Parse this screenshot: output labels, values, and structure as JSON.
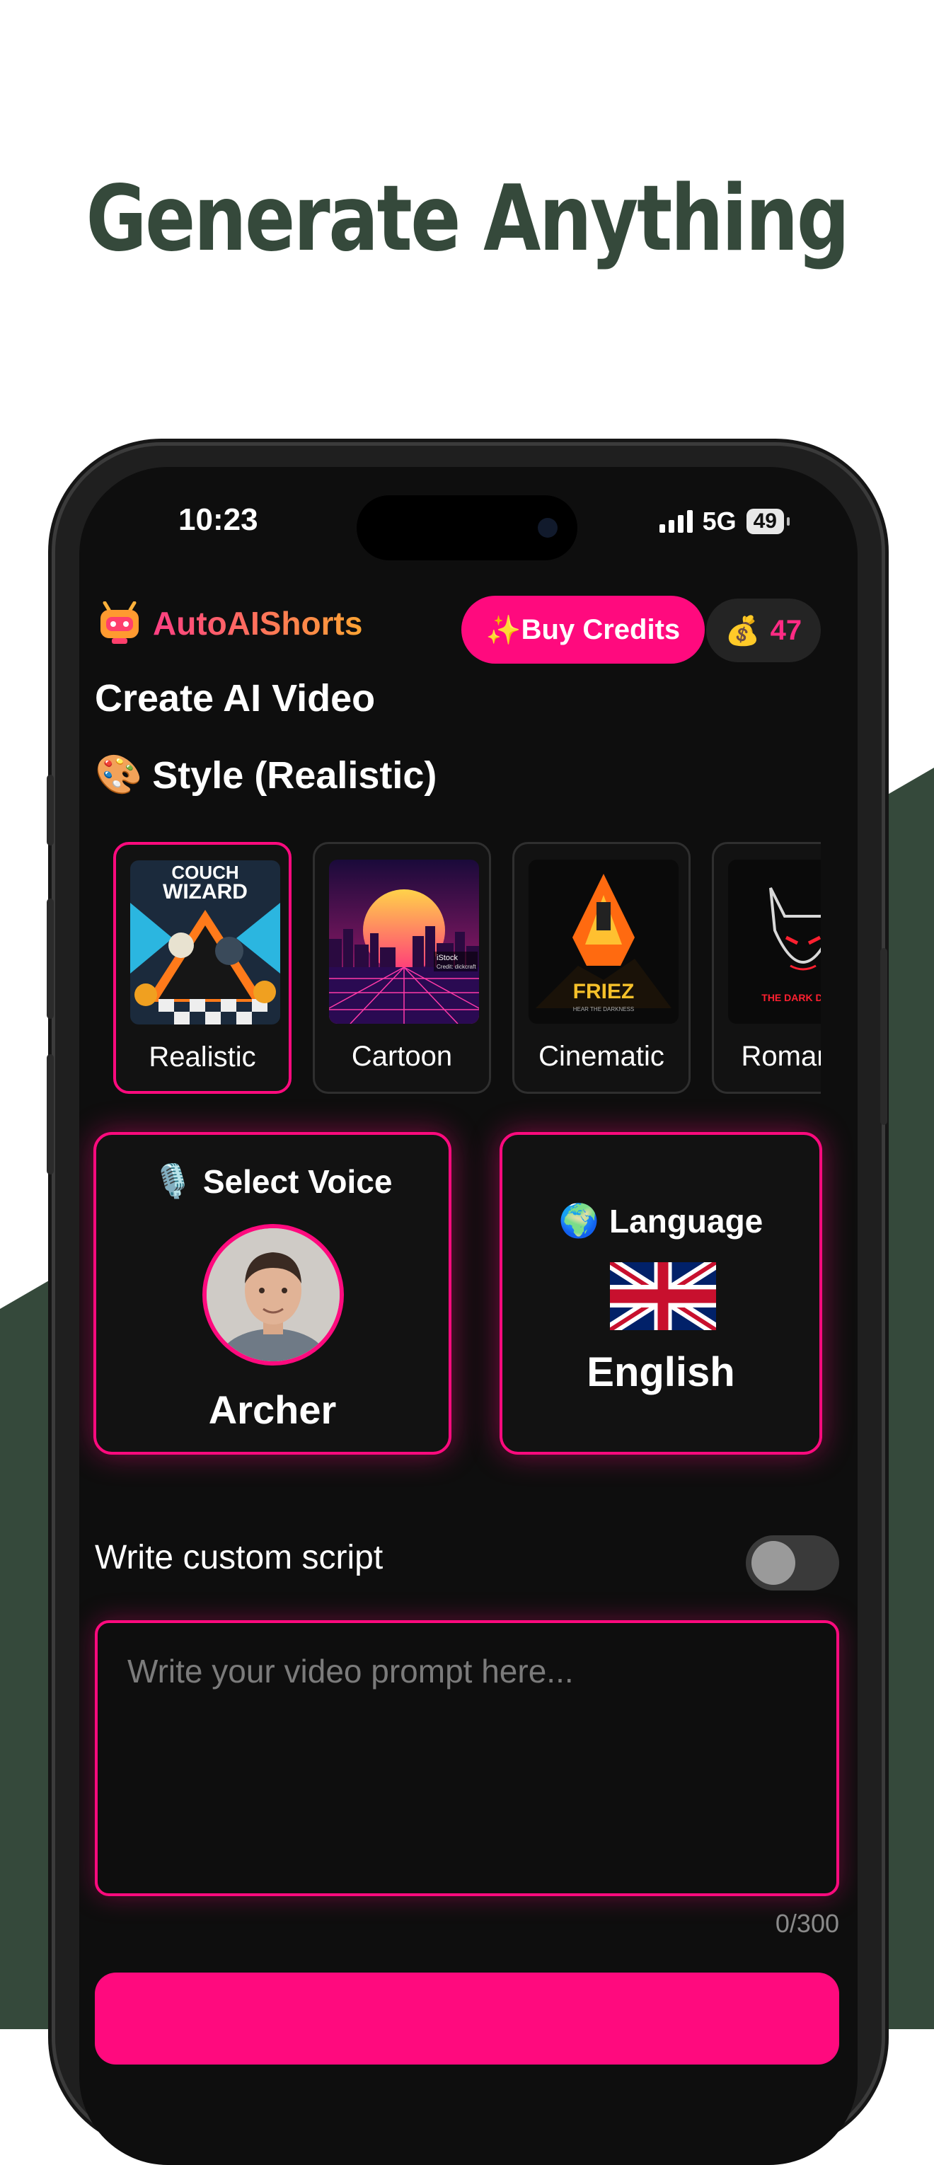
{
  "headline": "Generate Anything",
  "status_bar": {
    "time": "10:23",
    "network": "5G",
    "battery": "49"
  },
  "header": {
    "app_name": "AutoAIShorts",
    "buy_credits_label": "Buy Credits",
    "sparkle_emoji": "✨",
    "credits_emoji": "💰",
    "credits_count": "47"
  },
  "page_title": "Create AI Video",
  "style_section": {
    "emoji": "🎨",
    "title": "Style (Realistic)"
  },
  "styles": [
    {
      "label": "Realistic",
      "selected": true
    },
    {
      "label": "Cartoon",
      "selected": false
    },
    {
      "label": "Cinematic",
      "selected": false
    },
    {
      "label": "Romantic",
      "selected": false
    }
  ],
  "style_thumbs": {
    "realistic_text_1": "COUCH",
    "realistic_text_2": "WIZARD",
    "cartoon_text_1": "iStock",
    "cartoon_text_2": "Credit: dickcraft",
    "cinematic_text_1": "FRIEZ",
    "cinematic_text_2": "HEAR THE DARKNESS",
    "romantic_text": "THE DARK DEVIL"
  },
  "voice": {
    "emoji": "🎙️",
    "title": "Select Voice",
    "name": "Archer"
  },
  "language": {
    "emoji": "🌍",
    "title": "Language",
    "name": "English"
  },
  "custom_script": {
    "label": "Write custom script",
    "enabled": false
  },
  "prompt": {
    "placeholder": "Write your video prompt here...",
    "value": "",
    "count": "0/300"
  },
  "colors": {
    "accent": "#ff0a7e",
    "headline": "#35493b",
    "background": "#0e0e0e"
  }
}
